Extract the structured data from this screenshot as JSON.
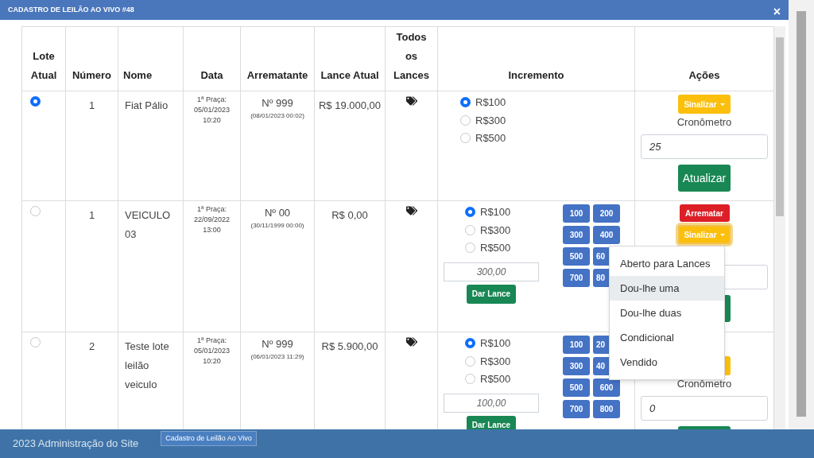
{
  "window": {
    "title": "CADASTRO DE LEILÃO AO VIVO #48",
    "close": "×"
  },
  "table": {
    "columns": [
      "Lote Atual",
      "Número",
      "Nome",
      "Data",
      "Arrematante",
      "Lance Atual",
      "Todos os Lances",
      "Incremento",
      "Ações"
    ],
    "rows": [
      {
        "selected": true,
        "number": "1",
        "name": "Fiat Pálio",
        "date_label": "1ª Praça:",
        "date": "05/01/2023",
        "time": "10:20",
        "bidder": "Nº 999",
        "bid_time": "(08/01/2023 00:02)",
        "current_bid": "R$ 19.000,00",
        "increments": [
          {
            "label": "R$100",
            "selected": true
          },
          {
            "label": "R$300",
            "selected": false
          },
          {
            "label": "R$500",
            "selected": false
          }
        ],
        "actions": {
          "sinalizar": "Sinalizar",
          "focused": false,
          "timer_label": "Cronômetro",
          "timer_value": "25",
          "submit": "Atualizar"
        }
      },
      {
        "selected": false,
        "number": "1",
        "name": "VEICULO 03",
        "date_label": "1ª Praça:",
        "date": "22/09/2022",
        "time": "13:00",
        "bidder": "Nº 00",
        "bid_time": "(30/11/1999 00:00)",
        "current_bid": "R$ 0,00",
        "increments": [
          {
            "label": "R$100",
            "selected": true
          },
          {
            "label": "R$300",
            "selected": false
          },
          {
            "label": "R$500",
            "selected": false
          }
        ],
        "bid_placeholder": "300,00",
        "bid_button": "Dar Lance",
        "quick": [
          "100",
          "200",
          "300",
          "400",
          "500",
          "60",
          "700",
          "80"
        ],
        "actions": {
          "arrematar": "Arrematar",
          "sinalizar": "Sinalizar",
          "focused": true
        },
        "menu": [
          {
            "label": "Aberto para Lances",
            "selected": false
          },
          {
            "label": "Dou-lhe uma",
            "selected": true
          },
          {
            "label": "Dou-lhe duas",
            "selected": false
          },
          {
            "label": "Condicional",
            "selected": false
          },
          {
            "label": "Vendido",
            "selected": false
          }
        ]
      },
      {
        "selected": false,
        "number": "2",
        "name": "Teste lote leilão veiculo",
        "date_label": "1ª Praça:",
        "date": "05/01/2023",
        "time": "10:20",
        "bidder": "Nº 999",
        "bid_time": "(06/01/2023 11:29)",
        "current_bid": "R$ 5.900,00",
        "increments": [
          {
            "label": "R$100",
            "selected": true
          },
          {
            "label": "R$300",
            "selected": false
          },
          {
            "label": "R$500",
            "selected": false
          }
        ],
        "bid_placeholder": "100,00",
        "bid_button": "Dar Lance",
        "quick": [
          "100",
          "20",
          "300",
          "40",
          "500",
          "600",
          "700",
          "800"
        ],
        "actions": {
          "covered": true,
          "timer_label": "Cronômetro",
          "timer_value": "0"
        }
      }
    ]
  },
  "footer": {
    "text": "2023 Administração do Site",
    "tab": "Cadastro de Leilão Ao Vivo"
  }
}
